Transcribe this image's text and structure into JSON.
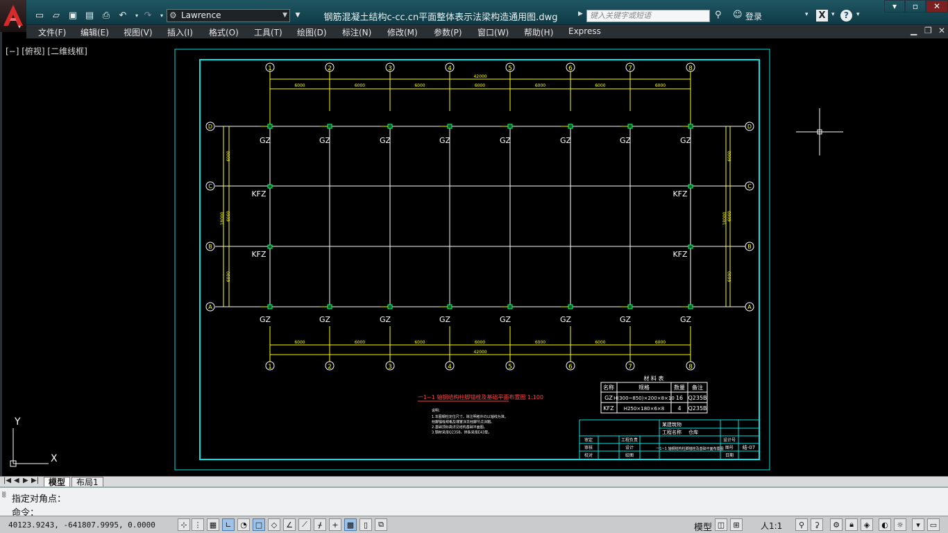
{
  "app": {
    "logo_letter": "A",
    "workspace": "Lawrence",
    "document_title": "钢筋混凝土结构c-cc.cn平面整体表示法梁构造通用图.dwg",
    "search_placeholder": "键入关键字或短语",
    "login_label": "登录",
    "x_label": "X",
    "help_label": "?"
  },
  "menu": [
    "文件(F)",
    "编辑(E)",
    "视图(V)",
    "插入(I)",
    "格式(O)",
    "工具(T)",
    "绘图(D)",
    "标注(N)",
    "修改(M)",
    "参数(P)",
    "窗口(W)",
    "帮助(H)",
    "Express"
  ],
  "viewport_label": "[−] [俯视] [二维线框]",
  "ucs": {
    "x_label": "X",
    "y_label": "Y"
  },
  "drawing": {
    "grid_cols": [
      "1",
      "2",
      "3",
      "4",
      "5",
      "6",
      "7",
      "8"
    ],
    "grid_rows": [
      "D",
      "C",
      "B",
      "A"
    ],
    "top_total": "42000",
    "bottom_total": "42000",
    "spans": [
      "6000",
      "6000",
      "6000",
      "6000",
      "6000",
      "6000",
      "6000"
    ],
    "left_spans": [
      "6000",
      "6000",
      "6000"
    ],
    "left_total": "18000",
    "gz_label": "GZ",
    "kfz_label": "KFZ",
    "plan_title": "一1~1 轴钢结构柱脚锚栓及基础平面布置图 1:100",
    "notes_heading": "说明：",
    "notes": [
      "1.本图钢柱定位尺寸，除注明者外均以轴线为准。",
      "  柱脚锚栓规格及埋置详见柱脚节点详图。",
      "2.基础顶标高详见结构基础平面图。",
      "3.钢材采用Q235B，焊条采用E43型。"
    ],
    "material_title": "材 料 表",
    "material_headers": [
      "名称",
      "规格",
      "数量",
      "备注"
    ],
    "material_rows": [
      [
        "GZ",
        "H(300~850)×200×8×10",
        "16",
        "Q235B"
      ],
      [
        "KFZ",
        "H250×180×6×8",
        "4",
        "Q235B"
      ]
    ],
    "title_block": {
      "r1": "某建筑物",
      "r2_label": "工程名称",
      "r2_value": "仓库",
      "left_labels": [
        "审定",
        "审核",
        "校对"
      ],
      "mid_labels": [
        "工程负责",
        "设计",
        "绘图"
      ],
      "drawing_name": "一1~1 轴钢结构柱脚锚栓及基础平面布置图",
      "right_labels": [
        "设计号",
        "图号",
        "日期"
      ],
      "right_values": [
        "",
        "结-07",
        ""
      ]
    }
  },
  "layout_tabs": [
    "模型",
    "布局1"
  ],
  "command": {
    "history": "指定对角点：",
    "prompt": "命令："
  },
  "status": {
    "coords": "40123.9243, -641807.9995, 0.0000",
    "model": "模型",
    "scale": "人1:1"
  }
}
